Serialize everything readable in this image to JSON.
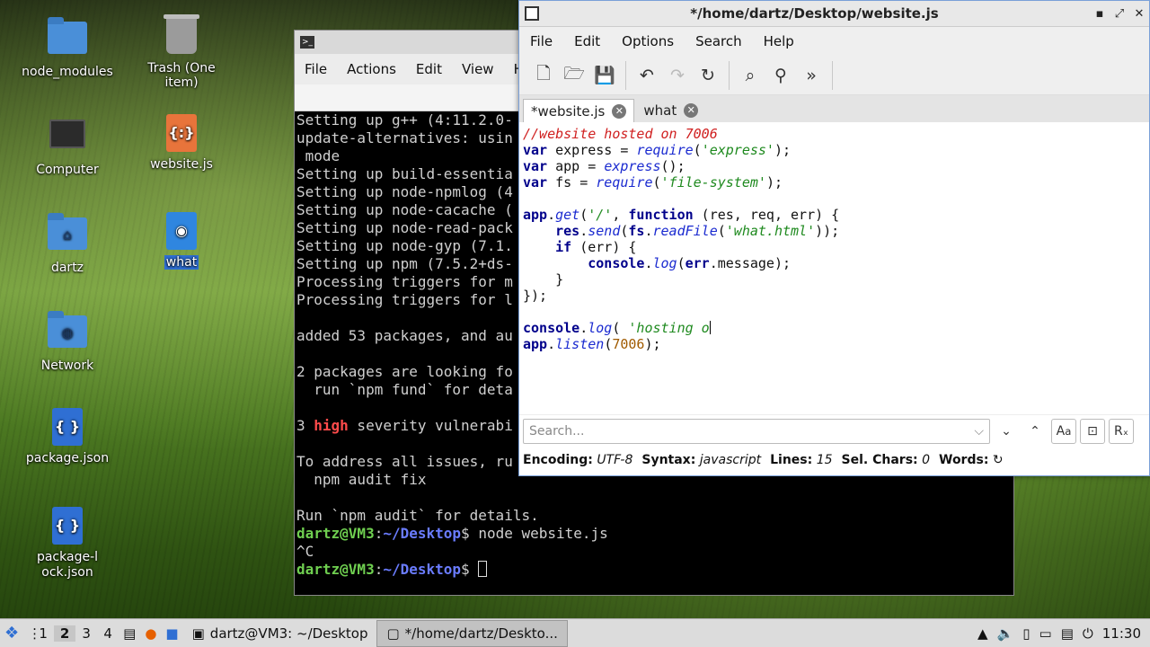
{
  "desktop": {
    "icons": [
      {
        "label": "node_modules",
        "icon": "folder-icon"
      },
      {
        "label": "Trash (One item)",
        "icon": "trash-icon"
      },
      {
        "label": "Computer",
        "icon": "computer-icon"
      },
      {
        "label": "website.js",
        "icon": "javascript-file-icon"
      },
      {
        "label": "dartz",
        "icon": "home-folder-icon"
      },
      {
        "label": "what",
        "icon": "html-file-icon"
      },
      {
        "label": "Network",
        "icon": "network-folder-icon"
      },
      {
        "label": "package.json",
        "icon": "json-file-icon"
      },
      {
        "label": "package-lock.json",
        "icon": "json-file-icon"
      }
    ]
  },
  "terminal": {
    "menu": [
      "File",
      "Actions",
      "Edit",
      "View",
      "Help"
    ],
    "title": "dartz@VM3: ~/Desktop",
    "lines": [
      "Setting up g++ (4:11.2.0-",
      "update-alternatives: usin",
      " mode",
      "Setting up build-essentia",
      "Setting up node-npmlog (4",
      "Setting up node-cacache (",
      "Setting up node-read-pack",
      "Setting up node-gyp (7.1.",
      "Setting up npm (7.5.2+ds-",
      "Processing triggers for m",
      "Processing triggers for l",
      "",
      "added 53 packages, and au",
      "",
      "2 packages are looking fo",
      "  run `npm fund` for deta",
      "",
      "severity vulnerabi",
      "",
      "To address all issues, ru",
      "  npm audit fix",
      "",
      "Run `npm audit` for details."
    ],
    "vuln_count": "3",
    "vuln_word": "high",
    "prompt_user": "dartz@VM3",
    "prompt_path": "~/Desktop",
    "cmd1": "node website.js",
    "interrupt": "^C"
  },
  "editor": {
    "title": "*/home/dartz/Desktop/website.js",
    "menu": [
      "File",
      "Edit",
      "Options",
      "Search",
      "Help"
    ],
    "tabs": [
      {
        "label": "*website.js",
        "active": true
      },
      {
        "label": "what",
        "active": false
      }
    ],
    "search_placeholder": "Search...",
    "status": {
      "encoding_label": "Encoding:",
      "encoding": "UTF-8",
      "syntax_label": "Syntax:",
      "syntax": "javascript",
      "lines_label": "Lines:",
      "lines": "15",
      "sel_label": "Sel. Chars:",
      "sel": "0",
      "words_label": "Words:"
    }
  },
  "taskbar": {
    "workspaces": [
      "1",
      "2",
      "3",
      "4"
    ],
    "current_workspace": "2",
    "tasks": [
      "dartz@VM3: ~/Desktop",
      "*/home/dartz/Deskto..."
    ],
    "clock": "11:30"
  }
}
